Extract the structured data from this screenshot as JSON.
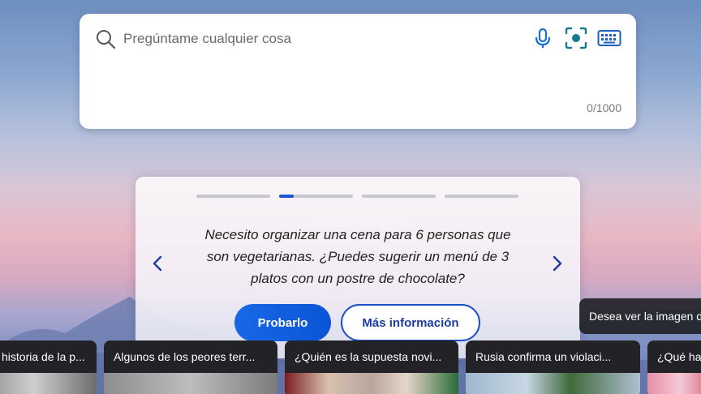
{
  "search": {
    "placeholder": "Pregúntame cualquier cosa",
    "char_count": "0/1000",
    "icons": [
      "search-icon",
      "microphone-icon",
      "visual-search-icon",
      "keyboard-icon"
    ]
  },
  "suggestion": {
    "slides_total": 4,
    "active_slide": 2,
    "active_progress": 0.2,
    "prompt": "Necesito organizar una cena para 6 personas que son vegetarianas. ¿Puedes sugerir un menú de 3 platos con un postre de chocolate?",
    "try_label": "Probarlo",
    "more_label": "Más información"
  },
  "image_info": {
    "label": "Desea ver la imagen dia"
  },
  "news": [
    {
      "title": "historia de la p..."
    },
    {
      "title": "Algunos de los peores terr..."
    },
    {
      "title": "¿Quién es la supuesta novi..."
    },
    {
      "title": "Rusia confirma un violaci..."
    },
    {
      "title": "¿Qué ha"
    }
  ],
  "colors": {
    "accent": "#1a56d6",
    "button_blue": "#0b55d6",
    "icon_blue": "#1a6fd6"
  }
}
